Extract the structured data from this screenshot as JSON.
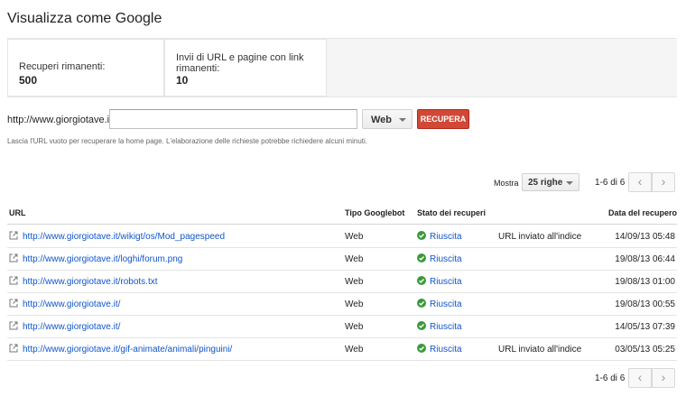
{
  "page_title": "Visualizza come Google",
  "stats": {
    "remaining_label": "Recuperi rimanenti:",
    "remaining_value": "500",
    "submissions_label": "Invii di URL e pagine con link rimanenti:",
    "submissions_value": "10"
  },
  "fetch_form": {
    "url_prefix": "http://www.giorgiotave.it/",
    "input_value": "",
    "googlebot_type": "Web",
    "fetch_button": "RECUPERA",
    "hint": "Lascia l'URL vuoto per recuperare la home page. L'elaborazione delle richieste potrebbe richiedere alcuni minuti."
  },
  "pagination": {
    "show_label": "Mostra",
    "rows_value": "25 righe",
    "range": "1-6 di 6"
  },
  "table": {
    "headers": {
      "url": "URL",
      "googlebot": "Tipo Googlebot",
      "status": "Stato dei recuperi",
      "date": "Data del recupero"
    },
    "rows": [
      {
        "url": "http://www.giorgiotave.it/wikigt/os/Mod_pagespeed",
        "googlebot": "Web",
        "status": "Riuscita",
        "index": "URL inviato all'indice",
        "date": "14/09/13 05:48"
      },
      {
        "url": "http://www.giorgiotave.it/loghi/forum.png",
        "googlebot": "Web",
        "status": "Riuscita",
        "index": "",
        "date": "19/08/13 06:44"
      },
      {
        "url": "http://www.giorgiotave.it/robots.txt",
        "googlebot": "Web",
        "status": "Riuscita",
        "index": "",
        "date": "19/08/13 01:00"
      },
      {
        "url": "http://www.giorgiotave.it/",
        "googlebot": "Web",
        "status": "Riuscita",
        "index": "",
        "date": "19/08/13 00:55"
      },
      {
        "url": "http://www.giorgiotave.it/",
        "googlebot": "Web",
        "status": "Riuscita",
        "index": "",
        "date": "14/05/13 07:39"
      },
      {
        "url": "http://www.giorgiotave.it/gif-animate/animali/pinguini/",
        "googlebot": "Web",
        "status": "Riuscita",
        "index": "URL inviato all'indice",
        "date": "03/05/13 05:25"
      }
    ]
  },
  "colors": {
    "link": "#1155cc",
    "primary_button": "#d14836",
    "success": "#3a9a3a"
  },
  "icons": {
    "external_link": "external-link-icon",
    "success": "check-circle-icon",
    "prev": "chevron-left-icon",
    "next": "chevron-right-icon",
    "dropdown": "caret-down-icon"
  }
}
